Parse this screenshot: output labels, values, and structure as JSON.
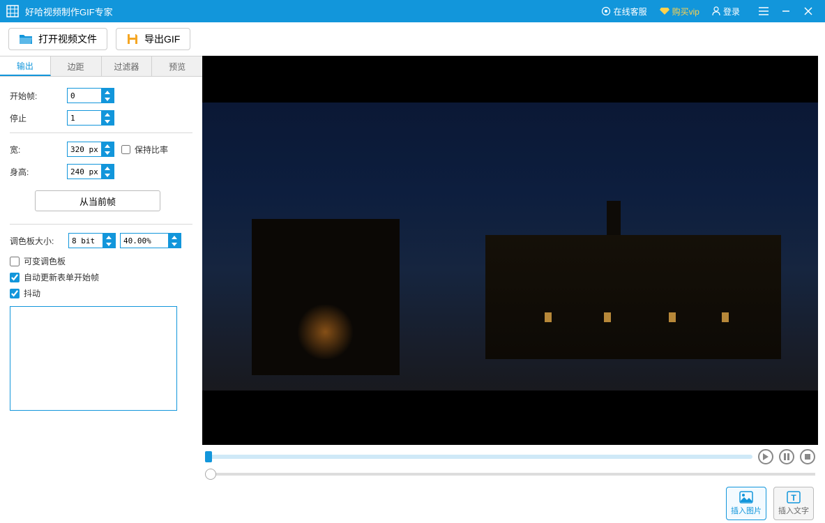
{
  "titlebar": {
    "app_title": "好哈视频制作GIF专家",
    "customer_service": "在线客服",
    "buy_vip": "购买vip",
    "login": "登录"
  },
  "toolbar": {
    "open_video": "打开视频文件",
    "export_gif": "导出GIF"
  },
  "tabs": [
    "输出",
    "边距",
    "过滤器",
    "预览"
  ],
  "output": {
    "start_frame_label": "开始帧:",
    "start_frame_value": "0",
    "stop_label": "停止",
    "stop_value": "1",
    "width_label": "宽:",
    "width_value": "320 px",
    "height_label": "身高:",
    "height_value": "240 px",
    "keep_ratio": "保持比率",
    "from_current_frame": "从当前帧",
    "palette_size_label": "调色板大小:",
    "palette_bits": "8 bit",
    "palette_pct": "40.00%",
    "variable_palette": "可变调色板",
    "auto_update_start": "自动更新表单开始帧",
    "dither": "抖动"
  },
  "bottom": {
    "insert_image": "插入图片",
    "insert_text": "插入文字"
  }
}
